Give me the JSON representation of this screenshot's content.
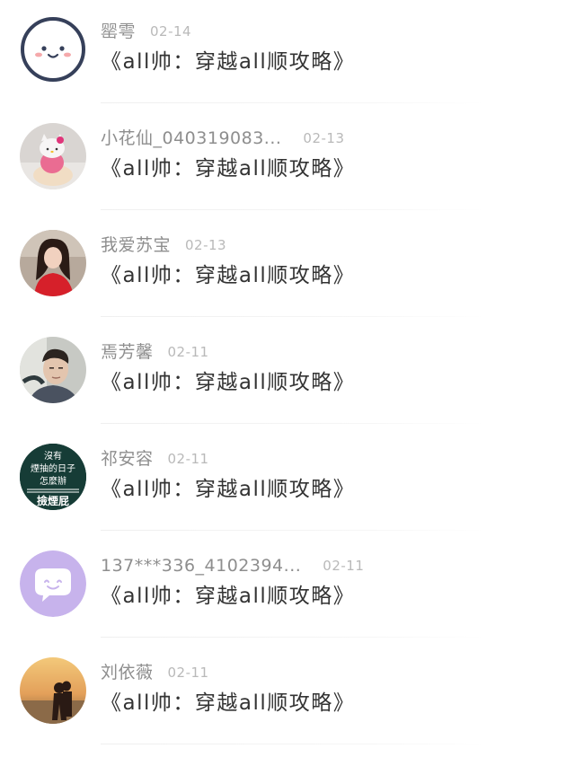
{
  "comments": [
    {
      "name": "罂雩",
      "date": "02-14",
      "title": "《all帅：穿越all顺攻略》",
      "avatar_icon": "smiley-face-avatar-icon"
    },
    {
      "name": "小花仙_040319083...",
      "date": "02-13",
      "title": "《all帅：穿越all顺攻略》",
      "avatar_icon": "hello-kitty-plush-avatar"
    },
    {
      "name": "我爱苏宝",
      "date": "02-13",
      "title": "《all帅：穿越all顺攻略》",
      "avatar_icon": "girl-red-shirt-avatar"
    },
    {
      "name": "焉芳馨",
      "date": "02-11",
      "title": "《all帅：穿越all顺攻略》",
      "avatar_icon": "boy-selfie-avatar"
    },
    {
      "name": "祁安容",
      "date": "02-11",
      "title": "《all帅：穿越all顺攻略》",
      "avatar_icon": "text-image-avatar",
      "avatar_text": [
        "沒有",
        "煙抽的日子",
        "怎麼辦",
        "撿煙屁"
      ]
    },
    {
      "name": "137***336_4102394...",
      "date": "02-11",
      "title": "《all帅：穿越all顺攻略》",
      "avatar_icon": "chat-bubble-avatar-icon"
    },
    {
      "name": "刘依薇",
      "date": "02-11",
      "title": "《all帅：穿越all顺攻略》",
      "avatar_icon": "sunset-couple-avatar"
    }
  ],
  "colors": {
    "name": "#8e8e8e",
    "date": "#b9b9b9",
    "title": "#333333",
    "divider": "#efefef",
    "avatar_outline_navy": "#36405a",
    "avatar_lavender": "#c7b3ec",
    "avatar_dark_green": "#163c36"
  }
}
